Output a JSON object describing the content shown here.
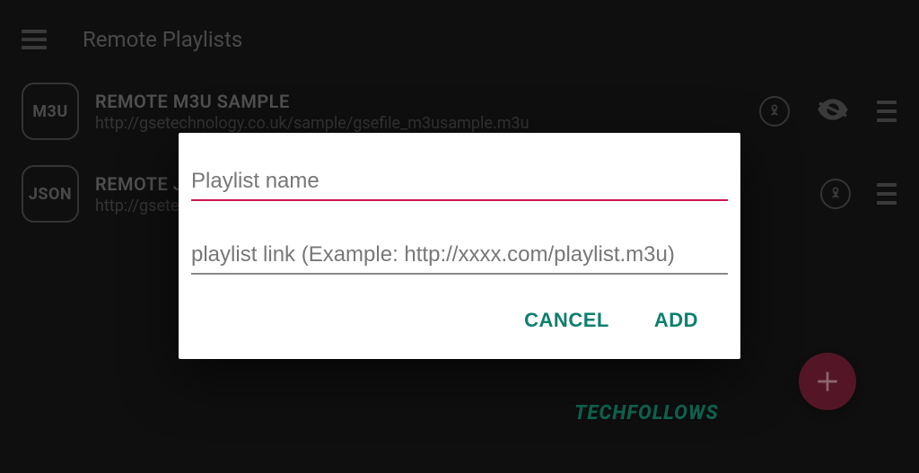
{
  "header": {
    "title": "Remote Playlists"
  },
  "playlists": [
    {
      "type": "M3U",
      "title": "REMOTE M3U SAMPLE",
      "url": "http://gsetechnology.co.uk/sample/gsefile_m3usample.m3u",
      "has_eye": true
    },
    {
      "type": "JSON",
      "title": "REMOTE JSON SAMPLE",
      "url": "http://gsetechnology.co.uk/sample/gsefile_jsonsample.json",
      "has_eye": false
    }
  ],
  "dialog": {
    "name_placeholder": "Playlist name",
    "link_placeholder": "playlist link (Example: http://xxxx.com/playlist.m3u)",
    "cancel_label": "CANCEL",
    "add_label": "ADD"
  },
  "watermark": "TECHFOLLOWS"
}
